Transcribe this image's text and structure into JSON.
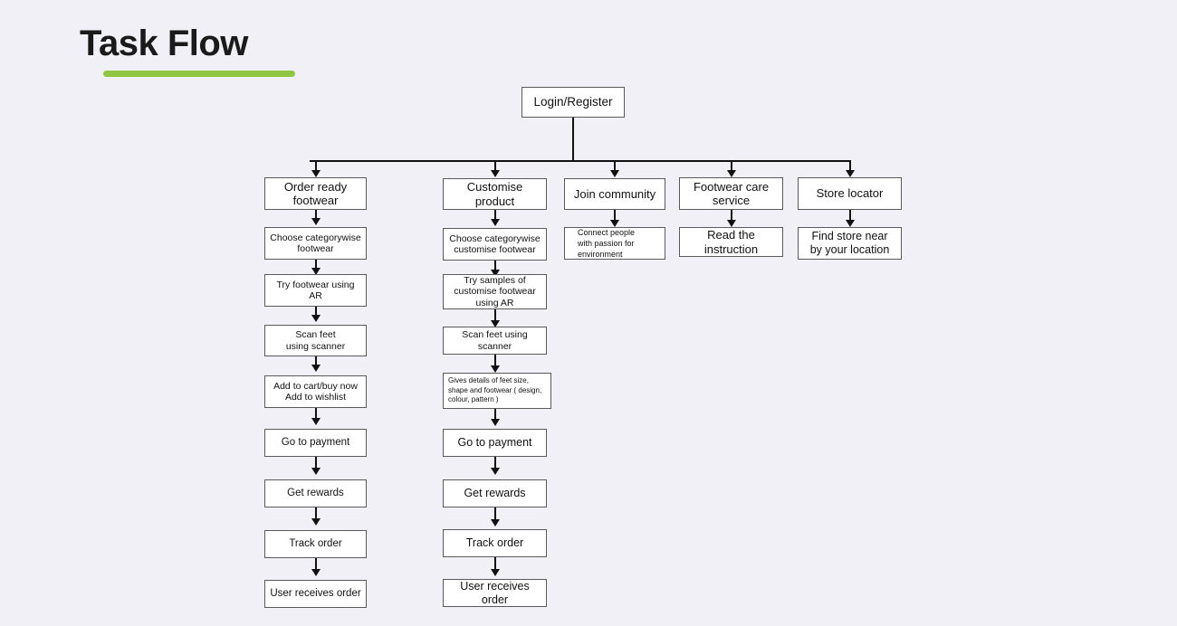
{
  "page": {
    "title": "Task Flow",
    "background_color": "#f1f0f6",
    "accent_color": "#8fc640",
    "node_border_color": "#5a5a5a",
    "connector_color": "#111111"
  },
  "diagram": {
    "type": "flowchart",
    "root": {
      "id": "login-register",
      "label": "Login/Register"
    },
    "branches": [
      {
        "id": "branch-order-ready-footwear",
        "name": "Order ready footwear",
        "steps": [
          {
            "id": "order-ready-footwear",
            "label": "Order ready\nfootwear"
          },
          {
            "id": "choose-categorywise-footwear",
            "label": "Choose categorywise\nfootwear"
          },
          {
            "id": "try-footwear-using-ar",
            "label": "Try footwear using\nAR"
          },
          {
            "id": "scan-feet-using-scanner",
            "label": "Scan feet\nusing scanner"
          },
          {
            "id": "add-to-cart-wishlist",
            "label": "Add to cart/buy now\nAdd to wishlist"
          },
          {
            "id": "go-to-payment",
            "label": "Go to payment"
          },
          {
            "id": "get-rewards",
            "label": "Get rewards"
          },
          {
            "id": "track-order",
            "label": "Track order"
          },
          {
            "id": "user-receives-order",
            "label": "User receives order"
          }
        ]
      },
      {
        "id": "branch-customise-product",
        "name": "Customise product",
        "steps": [
          {
            "id": "customise-product",
            "label": "Customise product"
          },
          {
            "id": "choose-categorywise-customise-footwear",
            "label": "Choose categorywise\ncustomise footwear"
          },
          {
            "id": "try-samples-customise-footwear-ar",
            "label": "Try samples of\ncustomise footwear\nusing AR"
          },
          {
            "id": "scan-feet-using-scanner-2",
            "label": "Scan feet using scanner"
          },
          {
            "id": "gives-details-of-feet",
            "label": "Gives details of feet size,\nshape and footwear ( design,\ncolour, pattern )"
          },
          {
            "id": "go-to-payment-2",
            "label": "Go to payment"
          },
          {
            "id": "get-rewards-2",
            "label": "Get rewards"
          },
          {
            "id": "track-order-2",
            "label": "Track order"
          },
          {
            "id": "user-receives-order-2",
            "label": "User receives order"
          }
        ]
      },
      {
        "id": "branch-join-community",
        "name": "Join community",
        "steps": [
          {
            "id": "join-community",
            "label": "Join community"
          },
          {
            "id": "connect-people-passion-environment",
            "label": "Connect people\nwith passion for\nenvironment"
          }
        ]
      },
      {
        "id": "branch-footwear-care-service",
        "name": "Footwear care service",
        "steps": [
          {
            "id": "footwear-care-service",
            "label": "Footwear care\nservice"
          },
          {
            "id": "read-the-instruction",
            "label": "Read the instruction"
          }
        ]
      },
      {
        "id": "branch-store-locator",
        "name": "Store locator",
        "steps": [
          {
            "id": "store-locator",
            "label": "Store locator"
          },
          {
            "id": "find-store-near-location",
            "label": "Find store near\nby your location"
          }
        ]
      }
    ]
  }
}
